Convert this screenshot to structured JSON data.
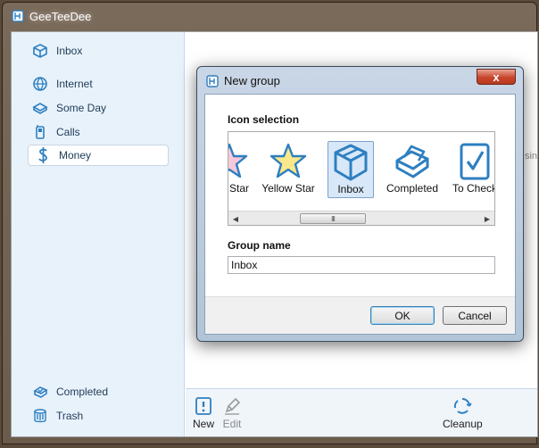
{
  "app": {
    "title": "GeeTeeDee"
  },
  "sidebar": {
    "items": [
      {
        "label": "Inbox",
        "icon": "box-icon"
      },
      {
        "label": "Internet",
        "icon": "globe-icon"
      },
      {
        "label": "Some Day",
        "icon": "tray-icon"
      },
      {
        "label": "Calls",
        "icon": "phone-icon"
      },
      {
        "label": "Money",
        "icon": "dollar-icon",
        "selected": true
      },
      {
        "label": "Completed",
        "icon": "completed-icon"
      },
      {
        "label": "Trash",
        "icon": "trash-icon"
      }
    ]
  },
  "content": {
    "partial_text": "sin"
  },
  "toolbar": {
    "new_label": "New",
    "edit_label": "Edit",
    "cleanup_label": "Cleanup"
  },
  "dialog": {
    "title": "New group",
    "close_label": "x",
    "icon_selection_label": "Icon selection",
    "icons": [
      {
        "label": "Star",
        "icon": "pink-star-icon"
      },
      {
        "label": "Yellow Star",
        "icon": "yellow-star-icon"
      },
      {
        "label": "Inbox",
        "icon": "box-icon",
        "selected": true
      },
      {
        "label": "Completed",
        "icon": "completed-icon"
      },
      {
        "label": "To Check",
        "icon": "checkbox-icon"
      }
    ],
    "scroll_grip": "III",
    "group_name_label": "Group name",
    "group_name_value": "Inbox",
    "ok_label": "OK",
    "cancel_label": "Cancel"
  },
  "colors": {
    "accent": "#2e7fc0",
    "sidebar_bg": "#e8f2fb",
    "dialog_frame": "#b8c9dc"
  }
}
